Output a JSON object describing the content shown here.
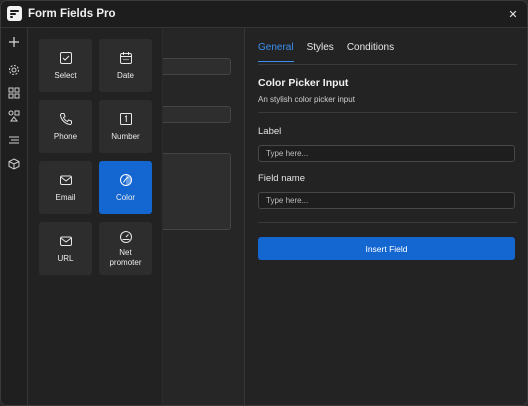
{
  "app": {
    "title": "Form Fields Pro"
  },
  "rail": {
    "icons": [
      "plus-icon",
      "gear-icon",
      "blocks-icon",
      "shapes-icon",
      "align-icon",
      "cube-icon"
    ]
  },
  "picker": {
    "tiles": [
      {
        "label": "Select",
        "icon": "checkbox-icon"
      },
      {
        "label": "Date",
        "icon": "calendar-icon"
      },
      {
        "label": "Phone",
        "icon": "phone-icon"
      },
      {
        "label": "Number",
        "icon": "number-icon"
      },
      {
        "label": "Email",
        "icon": "mail-icon"
      },
      {
        "label": "Color",
        "icon": "color-icon",
        "active": true
      },
      {
        "label": "URL",
        "icon": "mail-icon"
      },
      {
        "label": "Net\npromoter",
        "icon": "gauge-icon"
      }
    ]
  },
  "settings": {
    "tabs": [
      {
        "label": "General",
        "active": true
      },
      {
        "label": "Styles"
      },
      {
        "label": "Conditions"
      }
    ],
    "title": "Color Picker Input",
    "description": "An stylish color picker input",
    "label_field": {
      "label": "Label",
      "placeholder": "Type here..."
    },
    "name_field": {
      "label": "Field name",
      "placeholder": "Type here..."
    },
    "insert_button": "Insert Field"
  },
  "colors": {
    "accent": "#1467d1",
    "tab_active": "#3b8ff0",
    "background": "#232323"
  }
}
